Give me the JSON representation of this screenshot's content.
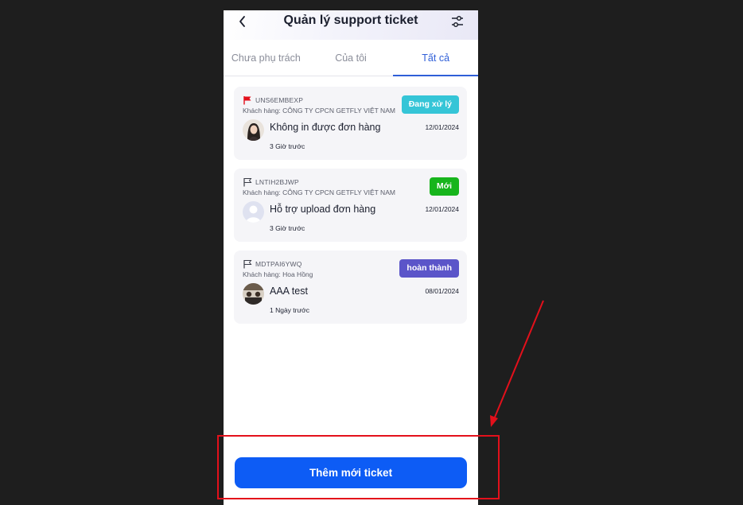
{
  "header": {
    "title": "Quản lý support ticket"
  },
  "tabs": [
    {
      "label": "Chưa phụ trách",
      "active": false
    },
    {
      "label": "Của tôi",
      "active": false
    },
    {
      "label": "Tất cả",
      "active": true
    }
  ],
  "tickets": [
    {
      "code": "UNS6EMBEXP",
      "customer": "Khách hàng: CÔNG TY CPCN GETFLY VIỆT NAM",
      "status": "Đang xử lý",
      "status_color": "#35c5d7",
      "flag": "red-flag-icon",
      "subject": "Không in được đơn hàng",
      "date": "12/01/2024",
      "ago": "3 Giờ trước"
    },
    {
      "code": "LNTIH2BJWP",
      "customer": "Khách hàng: CÔNG TY CPCN GETFLY VIỆT NAM",
      "status": "Mới",
      "status_color": "#17b51c",
      "flag": "outline-flag-icon",
      "subject": "Hỗ trợ  upload đơn hàng",
      "date": "12/01/2024",
      "ago": "3 Giờ trước"
    },
    {
      "code": "MDTPAI6YWQ",
      "customer": "Khách hàng: Hoa Hồng",
      "status": "hoàn thành",
      "status_color": "#5b55c9",
      "flag": "outline-flag-icon",
      "subject": "AAA test",
      "date": "08/01/2024",
      "ago": "1 Ngày trước"
    }
  ],
  "footer": {
    "add_button_label": "Thêm mới ticket"
  },
  "colors": {
    "accent": "#0d5cf5",
    "annotation": "#e3101b"
  }
}
